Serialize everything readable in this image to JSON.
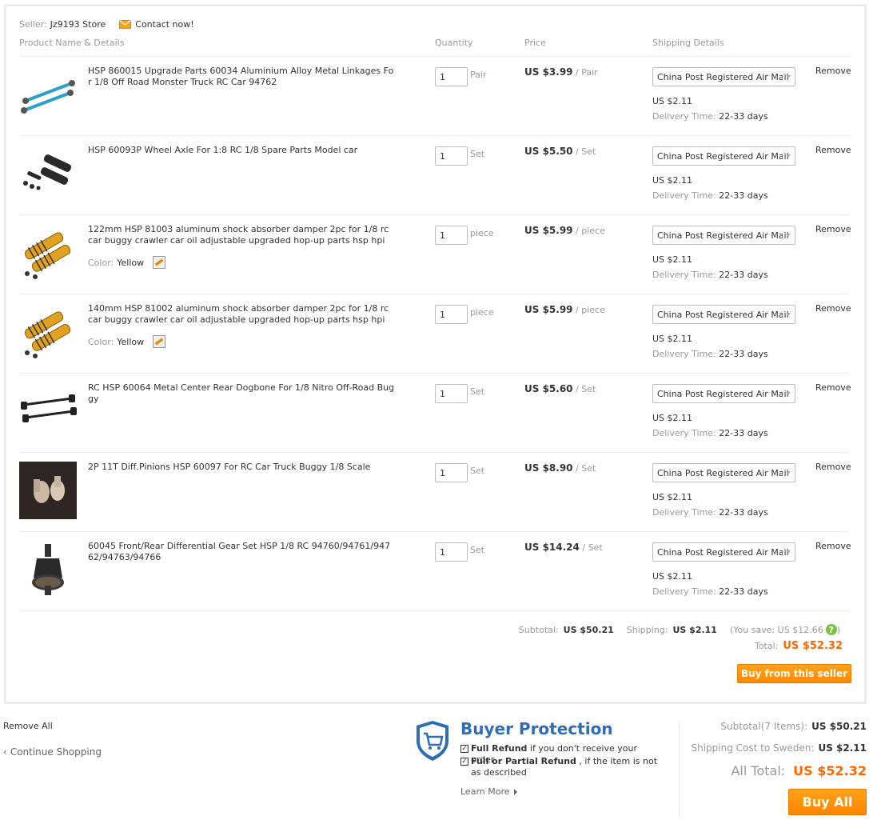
{
  "seller": {
    "label": "Seller:",
    "name": "Jz9193 Store",
    "contact": "Contact now!"
  },
  "columns": {
    "product": "Product Name & Details",
    "quantity": "Quantity",
    "price": "Price",
    "shipping": "Shipping Details"
  },
  "items": [
    {
      "name": "HSP 860015 Upgrade Parts 60034 Aluminium Alloy Metal Linkages For 1/8 Off Road Monster Truck RC Car 94762",
      "qty": "1",
      "unit": "Pair",
      "price": "US $3.99",
      "per": "/ Pair",
      "shipping_method": "China Post Registered Air Mail",
      "shipping_cost": "US $2.11",
      "delivery_label": "Delivery Time:",
      "delivery_time": "22-33 days",
      "remove": "Remove",
      "image_icon": "linkage-rod-icon"
    },
    {
      "name": "HSP 60093P Wheel Axle For 1:8 RC 1/8 Spare Parts Model car",
      "qty": "1",
      "unit": "Set",
      "price": "US $5.50",
      "per": "/ Set",
      "shipping_method": "China Post Registered Air Mail",
      "shipping_cost": "US $2.11",
      "delivery_label": "Delivery Time:",
      "delivery_time": "22-33 days",
      "remove": "Remove",
      "image_icon": "wheel-axle-icon"
    },
    {
      "name": "122mm HSP 81003 aluminum shock absorber damper 2pc for 1/8 rc car buggy crawler car oil adjustable upgraded hop-up parts hsp hpi",
      "color_label": "Color:",
      "color_value": "Yellow",
      "qty": "1",
      "unit": "piece",
      "price": "US $5.99",
      "per": "/ piece",
      "shipping_method": "China Post Registered Air Mail",
      "shipping_cost": "US $2.11",
      "delivery_label": "Delivery Time:",
      "delivery_time": "22-33 days",
      "remove": "Remove",
      "image_icon": "shock-absorber-icon"
    },
    {
      "name": "140mm HSP 81002 aluminum shock absorber damper 2pc for 1/8 rc car buggy crawler car oil adjustable upgraded hop-up parts hsp hpi",
      "color_label": "Color:",
      "color_value": "Yellow",
      "qty": "1",
      "unit": "piece",
      "price": "US $5.99",
      "per": "/ piece",
      "shipping_method": "China Post Registered Air Mail",
      "shipping_cost": "US $2.11",
      "delivery_label": "Delivery Time:",
      "delivery_time": "22-33 days",
      "remove": "Remove",
      "image_icon": "shock-absorber-icon"
    },
    {
      "name": "RC HSP 60064 Metal Center Rear Dogbone For 1/8 Nitro Off-Road Buggy",
      "qty": "1",
      "unit": "Set",
      "price": "US $5.60",
      "per": "/ Set",
      "shipping_method": "China Post Registered Air Mail",
      "shipping_cost": "US $2.11",
      "delivery_label": "Delivery Time:",
      "delivery_time": "22-33 days",
      "remove": "Remove",
      "image_icon": "dogbone-icon"
    },
    {
      "name": "2P 11T Diff.Pinions HSP 60097 For RC Car Truck Buggy 1/8 Scale",
      "qty": "1",
      "unit": "Set",
      "price": "US $8.90",
      "per": "/ Set",
      "shipping_method": "China Post Registered Air Mail",
      "shipping_cost": "US $2.11",
      "delivery_label": "Delivery Time:",
      "delivery_time": "22-33 days",
      "remove": "Remove",
      "image_icon": "pinion-gear-icon"
    },
    {
      "name": "60045 Front/Rear Differential Gear Set HSP 1/8 RC 94760/94761/94762/94763/94766",
      "qty": "1",
      "unit": "Set",
      "price": "US $14.24",
      "per": "/ Set",
      "shipping_method": "China Post Registered Air Mail",
      "shipping_cost": "US $2.11",
      "delivery_label": "Delivery Time:",
      "delivery_time": "22-33 days",
      "remove": "Remove",
      "image_icon": "differential-gear-icon"
    }
  ],
  "seller_summary": {
    "subtotal_label": "Subtotal:",
    "subtotal": "US $50.21",
    "shipping_label": "Shipping:",
    "shipping": "US $2.11",
    "save_text": "(You save: US $12.66",
    "save_close": ")",
    "total_label": "Total:",
    "total": "US $52.32",
    "buy_button": "Buy from this seller"
  },
  "footer": {
    "remove_all": "Remove All",
    "continue_shopping": "Continue Shopping",
    "protection_title": "Buyer Protection",
    "protection_items": [
      {
        "bold": "Full Refund",
        "text": " if you don't receive your order"
      },
      {
        "bold": "Full or Partial Refund",
        "text": " , if the item is not as described"
      }
    ],
    "learn_more": "Learn More",
    "subtotal_label": "Subtotal(7 Items):",
    "subtotal": "US $50.21",
    "shipping_label": "Shipping Cost to Sweden:",
    "shipping": "US $2.11",
    "all_total_label": "All Total:",
    "all_total": "US $52.32",
    "buy_all": "Buy All"
  },
  "colors": {
    "accent_orange": "#ff8a00",
    "price_orange": "#ff6600",
    "protection_blue": "#2f6eb5"
  }
}
